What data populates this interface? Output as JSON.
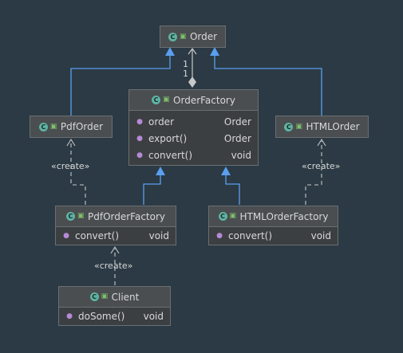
{
  "classes": {
    "order": {
      "name": "Order"
    },
    "order_factory": {
      "name": "OrderFactory",
      "members": [
        {
          "name": "order",
          "type": "Order"
        },
        {
          "name": "export()",
          "type": "Order"
        },
        {
          "name": "convert()",
          "type": "void"
        }
      ]
    },
    "pdf_order": {
      "name": "PdfOrder"
    },
    "html_order": {
      "name": "HTMLOrder"
    },
    "pdf_order_factory": {
      "name": "PdfOrderFactory",
      "members": [
        {
          "name": "convert()",
          "type": "void"
        }
      ]
    },
    "html_order_factory": {
      "name": "HTMLOrderFactory",
      "members": [
        {
          "name": "convert()",
          "type": "void"
        }
      ]
    },
    "client": {
      "name": "Client",
      "members": [
        {
          "name": "doSome()",
          "type": "void"
        }
      ]
    }
  },
  "labels": {
    "create": "«create»",
    "mult_top": "1",
    "mult_bottom": "1"
  },
  "icons": {
    "class": "class-c-icon",
    "visibility": "public-lock-icon",
    "member": "member-icon"
  },
  "colors": {
    "background": "#2b3a44",
    "inheritance_arrow": "#5a9ff0",
    "dependency_line": "#c8c8c8",
    "box_fill": "#3c3f41"
  }
}
